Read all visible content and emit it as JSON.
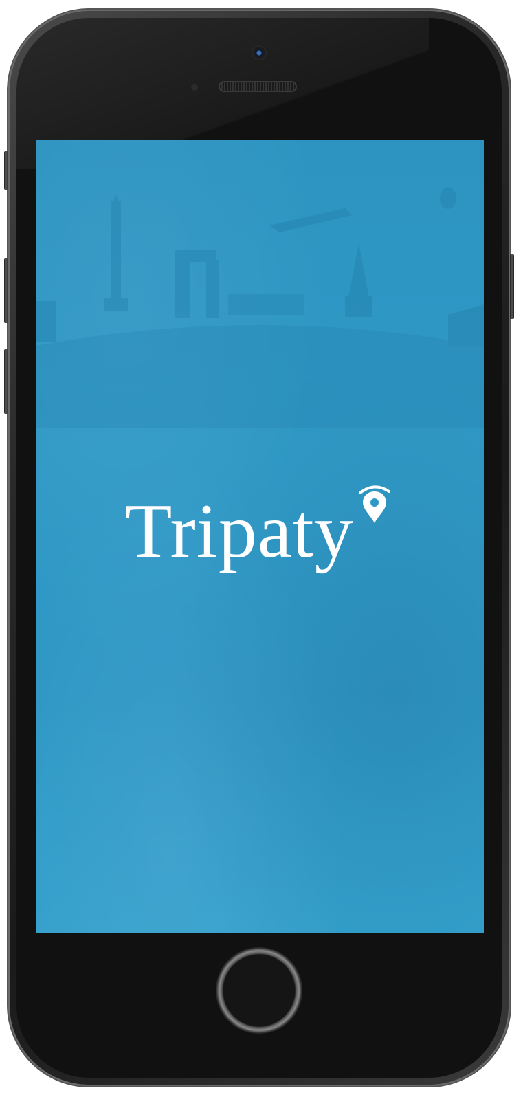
{
  "app": {
    "name": "Tripaty"
  },
  "splash": {
    "logo_text": "Tripaty",
    "logo_icon": "location-pin-icon",
    "background_icon": "world-landmarks-illustration"
  },
  "colors": {
    "screen_blue": "#2f97c5",
    "logo_white": "#ffffff",
    "phone_frame": "#1a1a1a"
  }
}
